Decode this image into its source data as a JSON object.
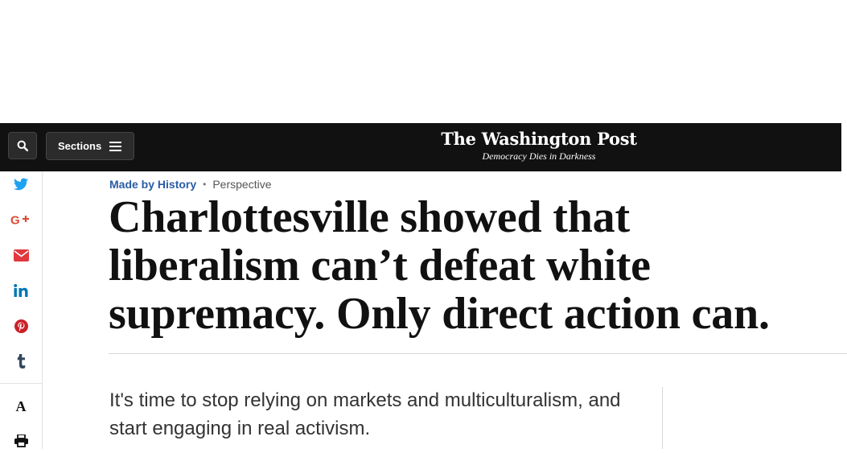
{
  "header": {
    "sections_label": "Sections",
    "logo": "The Washington Post",
    "tagline": "Democracy Dies in Darkness"
  },
  "share_rail": {
    "icons": [
      "twitter-icon",
      "google-plus-icon",
      "email-icon",
      "linkedin-icon",
      "pinterest-icon",
      "tumblr-icon",
      "text-size-icon",
      "print-icon"
    ],
    "text_size_label": "A"
  },
  "article": {
    "section": "Made by History",
    "label": "Perspective",
    "headline": "Charlottesville showed that liberalism can’t defeat white supremacy. Only direct action can.",
    "dek": "It's time to stop relying on markets and multiculturalism, and start engaging in real activism."
  },
  "colors": {
    "topbar": "#111111",
    "section_link": "#2a5ca6",
    "twitter": "#1da1f2",
    "google_plus": "#dd4b39",
    "email": "#e0393e",
    "linkedin": "#0077b5",
    "pinterest": "#cb2027",
    "tumblr": "#35465c"
  }
}
